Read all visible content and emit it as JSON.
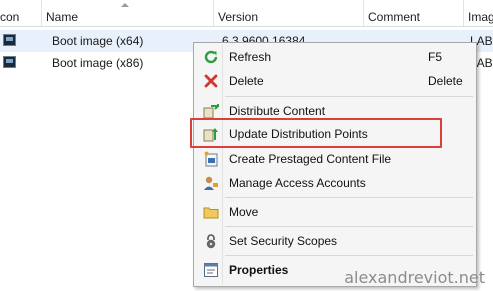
{
  "columns": [
    "con",
    "Name",
    "Version",
    "Comment",
    "Imag"
  ],
  "rows": [
    {
      "name": "Boot image (x64)",
      "version": "6.3.9600.16384",
      "image": "LAB"
    },
    {
      "name": "Boot image (x86)",
      "version": "",
      "image": "LAB"
    }
  ],
  "menu": {
    "items": [
      {
        "label": "Refresh",
        "shortcut": "F5",
        "icon": "refresh-icon"
      },
      {
        "label": "Delete",
        "shortcut": "Delete",
        "icon": "delete-icon"
      },
      {
        "label": "Distribute Content",
        "shortcut": "",
        "icon": "distribute-content-icon"
      },
      {
        "label": "Update Distribution Points",
        "shortcut": "",
        "icon": "update-distribution-points-icon"
      },
      {
        "label": "Create Prestaged Content File",
        "shortcut": "",
        "icon": "prestaged-content-icon"
      },
      {
        "label": "Manage Access Accounts",
        "shortcut": "",
        "icon": "manage-accounts-icon"
      },
      {
        "label": "Move",
        "shortcut": "",
        "icon": "folder-move-icon"
      },
      {
        "label": "Set Security Scopes",
        "shortcut": "",
        "icon": "lock-icon"
      },
      {
        "label": "Properties",
        "shortcut": "",
        "icon": "properties-icon"
      }
    ]
  },
  "watermark": "alexandreviot.net",
  "colors": {
    "highlight": "#d9403a",
    "selected_row": "#e8f0fb",
    "menu_bg": "#f5f5f5"
  }
}
